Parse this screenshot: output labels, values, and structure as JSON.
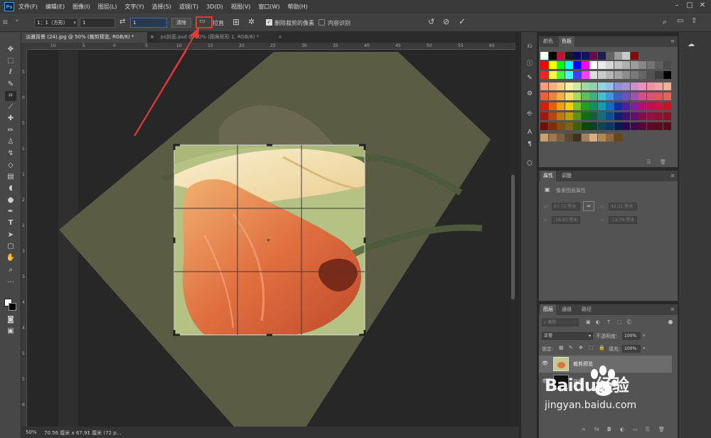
{
  "app": {
    "logo": "Ps"
  },
  "menu": [
    "文件(F)",
    "编辑(E)",
    "图像(I)",
    "图层(L)",
    "文字(Y)",
    "选择(S)",
    "滤镜(T)",
    "3D(D)",
    "视图(V)",
    "窗口(W)",
    "帮助(H)"
  ],
  "options": {
    "ratio_label": "1：1（方形）",
    "width_value": "1",
    "height_value": "1",
    "clear_label": "清除",
    "straighten_label": "拉直",
    "delete_cropped_label": "删除裁剪的像素",
    "content_aware_label": "内容识别",
    "delete_cropped_checked": true,
    "content_aware_checked": false
  },
  "doc_tabs": [
    {
      "title": "淡雅背景 (24).jpg @ 50% (裁剪预览, RGB/8) *",
      "active": true
    },
    {
      "title": "ps封面.psd @ 50% (圆角矩形 1, RGB/8) *",
      "active": false
    }
  ],
  "ruler_top": [
    "10",
    "5",
    "0",
    "5",
    "10",
    "15",
    "20",
    "25",
    "30",
    "35",
    "40",
    "45",
    "50",
    "55",
    "60"
  ],
  "ruler_left": [
    "5",
    "0",
    "5",
    "1",
    "1",
    "2",
    "2",
    "3",
    "3",
    "4",
    "4",
    "5",
    "5",
    "6"
  ],
  "status": {
    "zoom": "50%",
    "doc_info": "70.56 厘米 x 67.91 厘米 (72 p..."
  },
  "swatches_panel": {
    "tab_color": "颜色",
    "tab_swatches": "色板"
  },
  "properties_panel": {
    "tab_properties": "属性",
    "tab_adjustments": "调整",
    "subtitle": "像素图层属性",
    "w_label": "W:",
    "w_value": "67.73 厘米",
    "h_label": "H:",
    "h_value": "42.31 厘米",
    "x_label": "X:",
    "x_value": "-16.83 厘米",
    "y_label": "Y:",
    "y_value": "-12.36 厘米"
  },
  "layers_panel": {
    "tab_layers": "图层",
    "tab_channels": "通道",
    "tab_paths": "路径",
    "filter_placeholder": "类型",
    "blend_mode": "正常",
    "opacity_label": "不透明度:",
    "opacity_value": "100%",
    "lock_label": "锁定:",
    "fill_label": "填充:",
    "fill_value": "100%",
    "layers": [
      {
        "name": "裁剪预览",
        "selected": true
      },
      {
        "name": "背景",
        "selected": false
      }
    ]
  },
  "watermark": {
    "brand": "Baidu经验",
    "url": "jingyan.baidu.com"
  },
  "colors": {
    "accent_red": "#e53935",
    "ps_blue": "#31a8ff"
  },
  "swatch_rows": [
    [
      "#ffffff",
      "#000000",
      "#c8102e",
      "#1a1a1a",
      "#0a0a5a",
      "#14145a",
      "#6a0a4a",
      "#1e1e50",
      "#646464",
      "#9a9a9a",
      "#c8c8c8",
      "#8a0a0a"
    ],
    [
      "#ff0000",
      "#ffff00",
      "#00ff00",
      "#00ffff",
      "#0000ff",
      "#ff00ff",
      "#ffffff",
      "#ebebeb",
      "#d7d7d7",
      "#c3c3c3",
      "#afafaf",
      "#9b9b9b",
      "#878787",
      "#737373",
      "#5f5f5f",
      "#4b4b4b"
    ],
    [
      "#ff2020",
      "#ffff40",
      "#40ff40",
      "#40ffff",
      "#4040ff",
      "#ff40ff",
      "#dedede",
      "#cacaca",
      "#b6b6b6",
      "#a2a2a2",
      "#8e8e8e",
      "#7a7a7a",
      "#666666",
      "#525252",
      "#3e3e3e",
      "#000000"
    ],
    [
      "#f4a080",
      "#f8b080",
      "#fbd080",
      "#fff0a0",
      "#d0e8a0",
      "#a0d8a0",
      "#90d0b0",
      "#90d8e0",
      "#90c0e8",
      "#9090d8",
      "#a890d8",
      "#c890d0",
      "#e890c0",
      "#f090a0",
      "#f8a0a0",
      "#f4b090"
    ],
    [
      "#ec6040",
      "#f08040",
      "#f8b040",
      "#ffe060",
      "#b0d860",
      "#60c060",
      "#40b080",
      "#40c0d0",
      "#4098d8",
      "#4060c0",
      "#7050c0",
      "#a050b0",
      "#d05090",
      "#e05070",
      "#e85060",
      "#f06050"
    ],
    [
      "#d02010",
      "#e06010",
      "#f0a010",
      "#ffd000",
      "#80c020",
      "#20a020",
      "#109060",
      "#10a0b0",
      "#1070c0",
      "#1030a0",
      "#5020a0",
      "#8020a0",
      "#b01070",
      "#c01050",
      "#d01040",
      "#d01020"
    ],
    [
      "#a01810",
      "#b04810",
      "#c07810",
      "#c0a000",
      "#609010",
      "#107010",
      "#106040",
      "#107080",
      "#105090",
      "#102070",
      "#401070",
      "#601070",
      "#801050",
      "#901040",
      "#901030",
      "#901020"
    ],
    [
      "#701008",
      "#803008",
      "#805008",
      "#806800",
      "#406008",
      "#084808",
      "#084028",
      "#084858",
      "#083860",
      "#081850",
      "#280850",
      "#400850",
      "#580838",
      "#600828",
      "#600820",
      "#600818"
    ],
    [
      "#c8a078",
      "#a07850",
      "#786040",
      "#584830",
      "#403020",
      "#a08060",
      "#d8b080",
      "#b08850",
      "#906840",
      "#684818"
    ]
  ]
}
